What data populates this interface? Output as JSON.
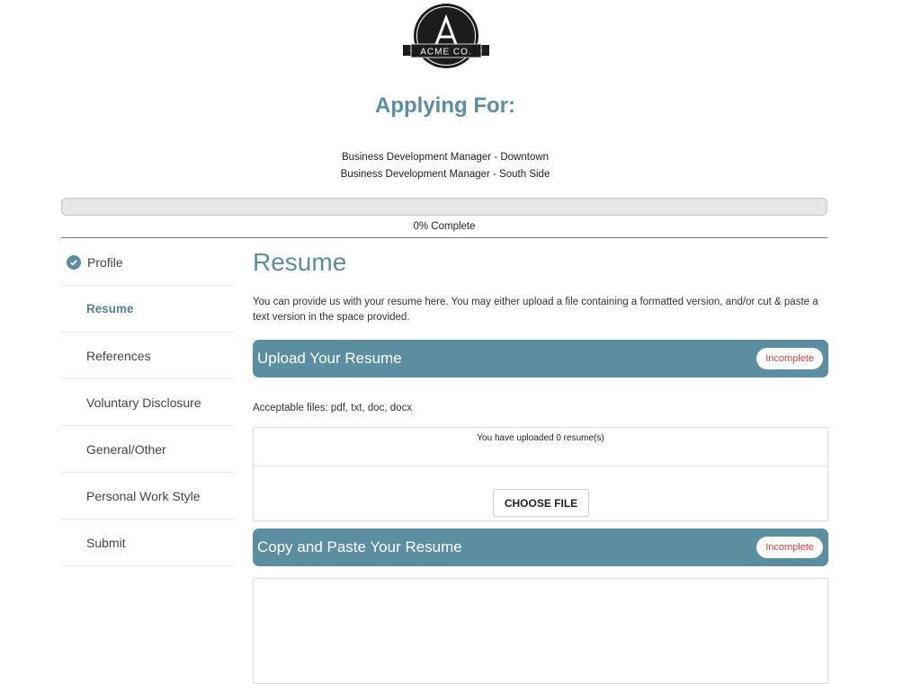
{
  "brand": {
    "logo_text": "ACME CO.",
    "logo_letter": "A"
  },
  "header": {
    "heading": "Applying For:",
    "positions": [
      "Business Development Manager - Downtown",
      "Business Development Manager - South Side"
    ]
  },
  "progress": {
    "percent": 0,
    "label": "0% Complete"
  },
  "sidebar": {
    "items": [
      {
        "label": "Profile",
        "status": "complete",
        "icon": "check-circle-icon"
      },
      {
        "label": "Resume",
        "status": "active"
      },
      {
        "label": "References"
      },
      {
        "label": "Voluntary Disclosure"
      },
      {
        "label": "General/Other"
      },
      {
        "label": "Personal Work Style"
      },
      {
        "label": "Submit"
      }
    ]
  },
  "main": {
    "title": "Resume",
    "intro": "You can provide us with your resume here. You may either upload a file containing a formatted version, and/or cut & paste a text version in the space provided.",
    "upload": {
      "title": "Upload Your Resume",
      "status": "Incomplete",
      "acceptable": "Acceptable files: pdf, txt, doc, docx",
      "count_text": "You have uploaded 0 resume(s)",
      "button": "CHOOSE FILE"
    },
    "paste": {
      "title": "Copy and Paste Your Resume",
      "status": "Incomplete",
      "value": ""
    }
  },
  "colors": {
    "accent": "#5b8ea0",
    "incomplete": "#e0453c"
  }
}
